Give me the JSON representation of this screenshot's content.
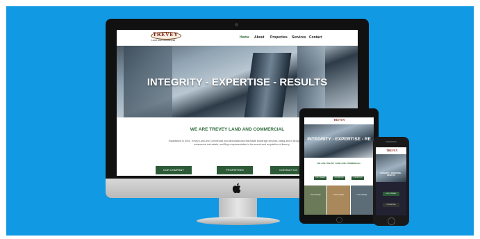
{
  "site": {
    "logo_text": "TREVEY",
    "logo_sub": "Land and Commercial",
    "nav": [
      "Home",
      "About",
      "Properties",
      "Services",
      "Contact"
    ],
    "hero_title": "INTEGRITY - EXPERTISE - RESULTS",
    "about_title": "WE ARE TREVEY LAND AND COMMERCIAL",
    "about_text": "Established in 2001, Trevey Land and Commercial provides traditional real estate brokerage services, listing and of all types of land and commercial real estate, and Buyer representation in the search and acquisition of these p",
    "buttons": [
      "OUR COMPANY",
      "PROPERTIES",
      "CONTACT US"
    ]
  },
  "tablet": {
    "hero_title": "INTEGRITY - EXPERTISE - RE",
    "about_title": "WE ARE TREVEY LAND AND COMMERCIAL",
    "grid": [
      "Land Listings",
      "Land Listings",
      "Land Listings"
    ]
  },
  "phone": {
    "title": "INTEGRITY · EXPERTISE · RESULTS",
    "buttons": [
      "OUR COMPANY",
      "PROPERTIES"
    ]
  },
  "colors": {
    "background": "#1199e3",
    "accent_green": "#2c5a37",
    "logo_red": "#7c1d12"
  }
}
